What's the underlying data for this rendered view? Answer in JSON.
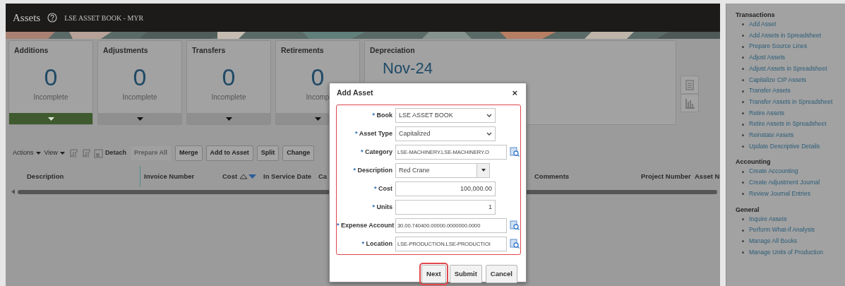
{
  "header": {
    "title": "Assets",
    "book": "LSE ASSET BOOK - MYR"
  },
  "cards": [
    {
      "title": "Additions",
      "count": "0",
      "label": "Incomplete",
      "selected": true
    },
    {
      "title": "Adjustments",
      "count": "0",
      "label": "Incomplete",
      "selected": false
    },
    {
      "title": "Transfers",
      "count": "0",
      "label": "Incomplete",
      "selected": false
    },
    {
      "title": "Retirements",
      "count": "0",
      "label": "Incomp",
      "selected": false
    }
  ],
  "depreciation": {
    "title": "Depreciation",
    "value": "Nov-24"
  },
  "toolbar": [
    {
      "kind": "menu",
      "label": "Actions"
    },
    {
      "kind": "menu",
      "label": "View"
    },
    {
      "kind": "icon"
    },
    {
      "kind": "icon"
    },
    {
      "kind": "detach",
      "label": "Detach"
    },
    {
      "kind": "button",
      "label": "Prepare All",
      "disabled": true
    },
    {
      "kind": "button",
      "label": "Merge",
      "disabled": false
    },
    {
      "kind": "button",
      "label": "Add to Asset",
      "disabled": false
    },
    {
      "kind": "button",
      "label": "Split",
      "disabled": false
    },
    {
      "kind": "button",
      "label": "Change",
      "disabled": false
    }
  ],
  "table": {
    "columns": [
      {
        "label": "Description"
      },
      {
        "label": "Invoice Number"
      },
      {
        "label": "Cost",
        "sortable": true
      },
      {
        "label": "In Service Date"
      },
      {
        "label": "Ca"
      },
      {
        "label": "Comments"
      },
      {
        "label": "Project Number"
      },
      {
        "label": "Asset N"
      }
    ]
  },
  "tasks": [
    {
      "heading": "Transactions",
      "items": [
        "Add Asset",
        "Add Assets in Spreadsheet",
        "Prepare Source Lines",
        "Adjust Assets",
        "Adjust Assets in Spreadsheet",
        "Capitalize CIP Assets",
        "Transfer Assets",
        "Transfer Assets in Spreadsheet",
        "Retire Assets",
        "Retire Assets in Spreadsheet",
        "Reinstate Assets",
        "Update Descriptive Details"
      ]
    },
    {
      "heading": "Accounting",
      "items": [
        "Create Accounting",
        "Create Adjustment Journal",
        "Review Journal Entries"
      ]
    },
    {
      "heading": "General",
      "items": [
        "Inquire Assets",
        "Perform What-if Analysis",
        "Manage All Books",
        "Manage Units of Production"
      ]
    }
  ],
  "dialog": {
    "title": "Add Asset",
    "close": "×",
    "fields": [
      {
        "kind": "select",
        "required_mark": "*",
        "label": "Book",
        "value": "LSE ASSET BOOK"
      },
      {
        "kind": "select",
        "required_mark": "*",
        "label": "Asset Type",
        "value": "Capitalized"
      },
      {
        "kind": "lookup",
        "required_mark": "*",
        "label": "Category",
        "value": "LSE-MACHINERY.LSE-MACHINERY.O"
      },
      {
        "kind": "combo",
        "required_mark": "*",
        "label": "Description",
        "value": "Red Crane"
      },
      {
        "kind": "number",
        "required_mark": "*",
        "label": "Cost",
        "value": "100,000.00"
      },
      {
        "kind": "number",
        "required_mark": "*",
        "label": "Units",
        "value": "1"
      },
      {
        "kind": "lookup",
        "required_mark": "*",
        "label": "Expense Account",
        "value": "30.00.740400.00000.0000000.0000"
      },
      {
        "kind": "lookup",
        "required_mark": "*",
        "label": "Location",
        "value": "LSE-PRODUCTION.LSE-PRODUCTIOI"
      }
    ],
    "buttons": [
      {
        "label": "Next",
        "highlighted": true
      },
      {
        "label": "Submit",
        "highlighted": false
      },
      {
        "label": "Cancel",
        "highlighted": false
      }
    ]
  }
}
